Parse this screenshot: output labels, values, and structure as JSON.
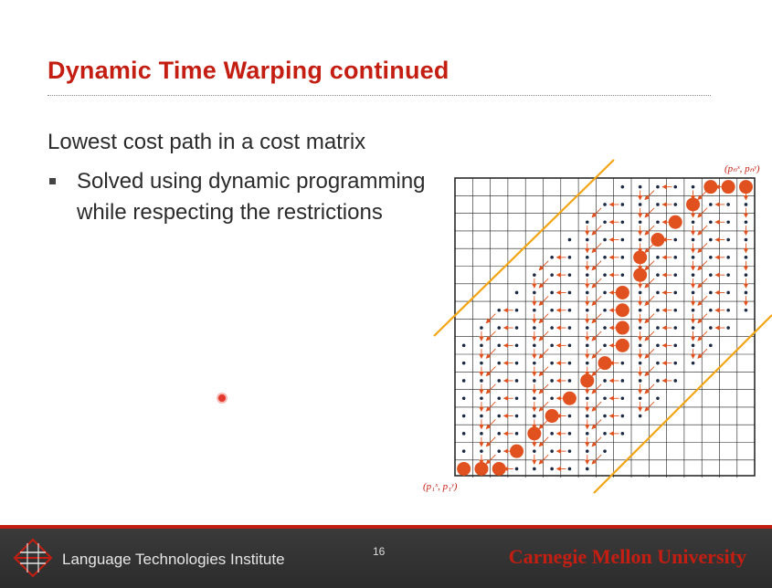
{
  "slide": {
    "title": "Dynamic Time Warping continued",
    "subtitle": "Lowest cost path in a cost matrix",
    "bullet": "Solved using dynamic programming while respecting the restrictions",
    "page_number": "16"
  },
  "figure": {
    "label_top_right": "(pₙˣ, pₙʸ)",
    "label_bottom_left": "(p₁ˣ, p₁ʸ)",
    "colors": {
      "grid": "#1c1c1c",
      "dot": "#1d2a44",
      "arrow": "#e0511f",
      "path": "#e0511f",
      "band": "#f2a413"
    }
  },
  "footer": {
    "institute": "Language Technologies Institute",
    "university": "Carnegie Mellon University"
  },
  "icons": [
    "lti-logo-icon",
    "laser-pointer-icon"
  ]
}
